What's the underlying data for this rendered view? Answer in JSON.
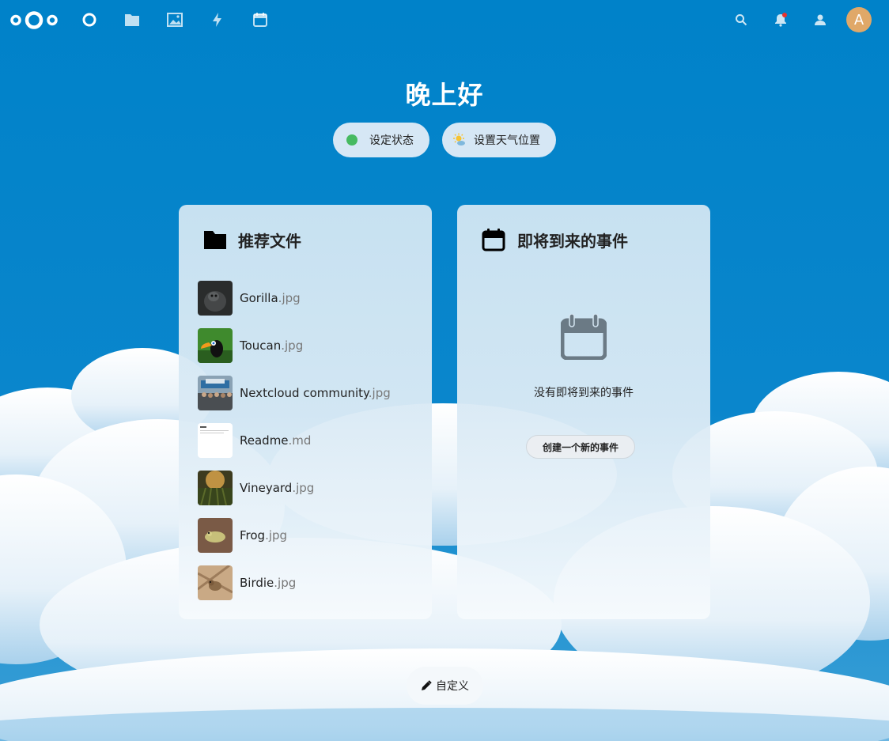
{
  "header": {
    "nav_icons": [
      "dashboard-icon",
      "files-icon",
      "photos-icon",
      "activity-icon",
      "calendar-icon"
    ],
    "right_icons": [
      "search-icon",
      "notifications-icon",
      "contacts-icon"
    ],
    "avatar_initial": "A"
  },
  "greeting": "晚上好",
  "status_button": "设定状态",
  "weather_button": "设置天气位置",
  "files_panel": {
    "title": "推荐文件",
    "files": [
      {
        "name": "Gorilla",
        "ext": ".jpg"
      },
      {
        "name": "Toucan",
        "ext": ".jpg"
      },
      {
        "name": "Nextcloud community",
        "ext": ".jpg"
      },
      {
        "name": "Readme",
        "ext": ".md"
      },
      {
        "name": "Vineyard",
        "ext": ".jpg"
      },
      {
        "name": "Frog",
        "ext": ".jpg"
      },
      {
        "name": "Birdie",
        "ext": ".jpg"
      }
    ]
  },
  "events_panel": {
    "title": "即将到来的事件",
    "empty_text": "没有即将到来的事件",
    "create_button": "创建一个新的事件"
  },
  "customize_button": "自定义",
  "colors": {
    "brand": "#0082c9",
    "status_online": "#46ba61",
    "avatar": "#e0a868"
  }
}
